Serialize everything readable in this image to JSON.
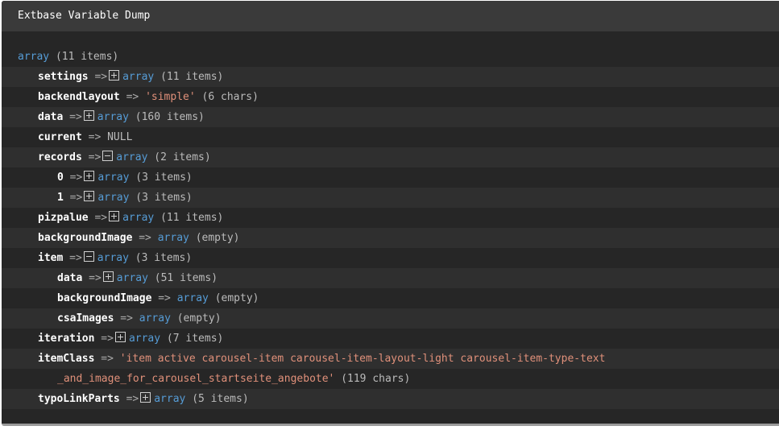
{
  "header": {
    "title": "Extbase Variable Dump"
  },
  "root": {
    "type": "array",
    "meta": "(11 items)"
  },
  "arrow": "=>",
  "rows": [
    {
      "key": "settings",
      "type": "array",
      "meta": "(11 items)"
    },
    {
      "key": "backendlayout",
      "value": "'simple'",
      "meta": "(6 chars)"
    },
    {
      "key": "data",
      "type": "array",
      "meta": "(160 items)"
    },
    {
      "key": "current",
      "value": "NULL"
    },
    {
      "key": "records",
      "type": "array",
      "meta": "(2 items)"
    },
    {
      "key": "0",
      "type": "array",
      "meta": "(3 items)"
    },
    {
      "key": "1",
      "type": "array",
      "meta": "(3 items)"
    },
    {
      "key": "pizpalue",
      "type": "array",
      "meta": "(11 items)"
    },
    {
      "key": "backgroundImage",
      "type": "array",
      "meta": "(empty)"
    },
    {
      "key": "item",
      "type": "array",
      "meta": "(3 items)"
    },
    {
      "key": "data",
      "type": "array",
      "meta": "(51 items)"
    },
    {
      "key": "backgroundImage",
      "type": "array",
      "meta": "(empty)"
    },
    {
      "key": "csaImages",
      "type": "array",
      "meta": "(empty)"
    },
    {
      "key": "iteration",
      "type": "array",
      "meta": "(7 items)"
    },
    {
      "key": "itemClass",
      "value": "'item active carousel-item carousel-item-layout-light carousel-item-type-text",
      "value_cont": "_and_image_for_carousel_startseite_angebote'",
      "meta": "(119 chars)"
    },
    {
      "key": "typoLinkParts",
      "type": "array",
      "meta": "(5 items)"
    }
  ]
}
